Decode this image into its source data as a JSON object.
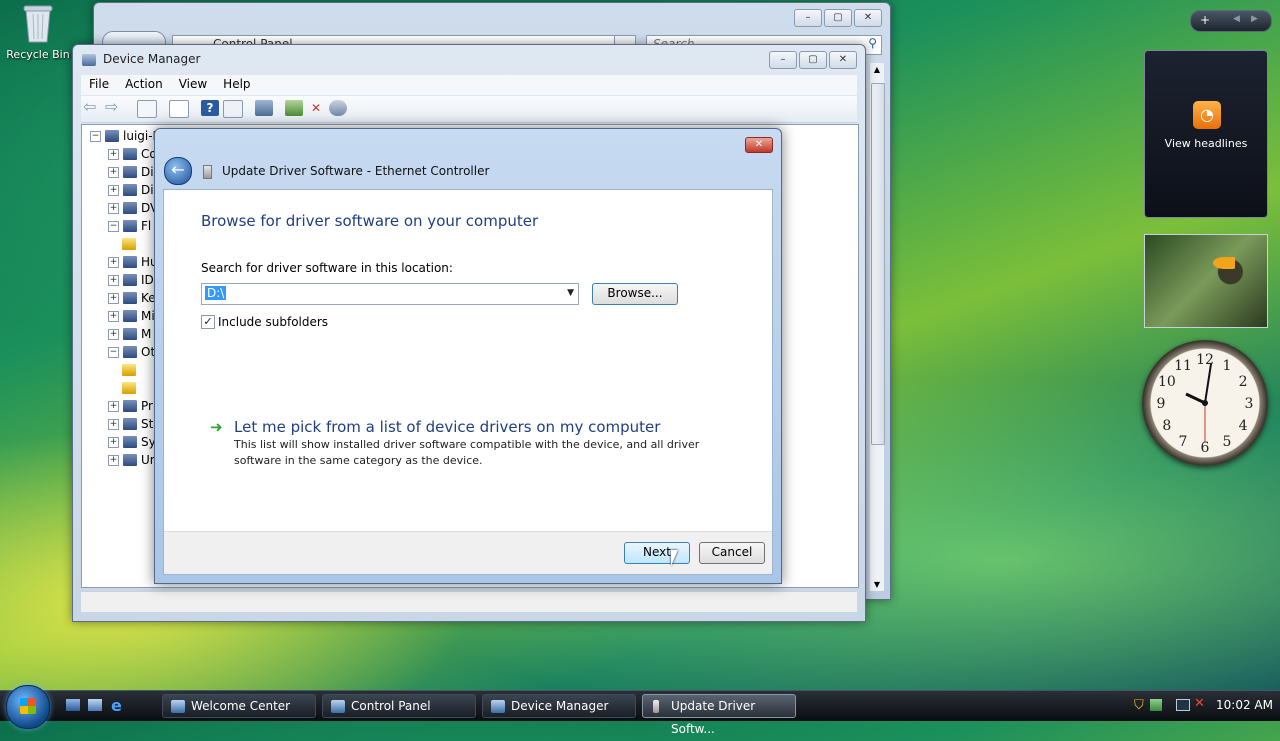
{
  "desktop": {
    "recycle_bin_label": "Recycle Bin"
  },
  "control_panel": {
    "address_text": "Control Panel",
    "search_placeholder": "Search"
  },
  "device_manager": {
    "title": "Device Manager",
    "menu": [
      "File",
      "Action",
      "View",
      "Help"
    ],
    "tree_root": "luigi-P",
    "tree_items": [
      "Co",
      "Di",
      "Di",
      "DV",
      "Fl",
      "",
      "Hu",
      "ID",
      "Ke",
      "Mi",
      "M",
      "Ot",
      "",
      "",
      "Pr",
      "St",
      "Sy",
      "Ur"
    ]
  },
  "dialog": {
    "title": "Update Driver Software - Ethernet Controller",
    "heading": "Browse for driver software on your computer",
    "search_label": "Search for driver software in this location:",
    "path_value": "D:\\",
    "browse_label": "Browse...",
    "include_subfolders_label": "Include subfolders",
    "include_subfolders_checked": true,
    "pick_link": "Let me pick from a list of device drivers on my computer",
    "pick_desc_1": "This list will show installed driver software compatible with the device, and all driver",
    "pick_desc_2": "software in the same category as the device.",
    "next_label": "Next",
    "cancel_label": "Cancel"
  },
  "sidebar": {
    "feed_label": "View headlines"
  },
  "taskbar": {
    "buttons": [
      "Welcome Center",
      "Control Panel",
      "Device Manager",
      "Update Driver Softw..."
    ],
    "clock": "10:02 AM"
  },
  "clock_gadget": {
    "numbers": [
      "12",
      "1",
      "2",
      "3",
      "4",
      "5",
      "6",
      "7",
      "8",
      "9",
      "10",
      "11"
    ]
  }
}
